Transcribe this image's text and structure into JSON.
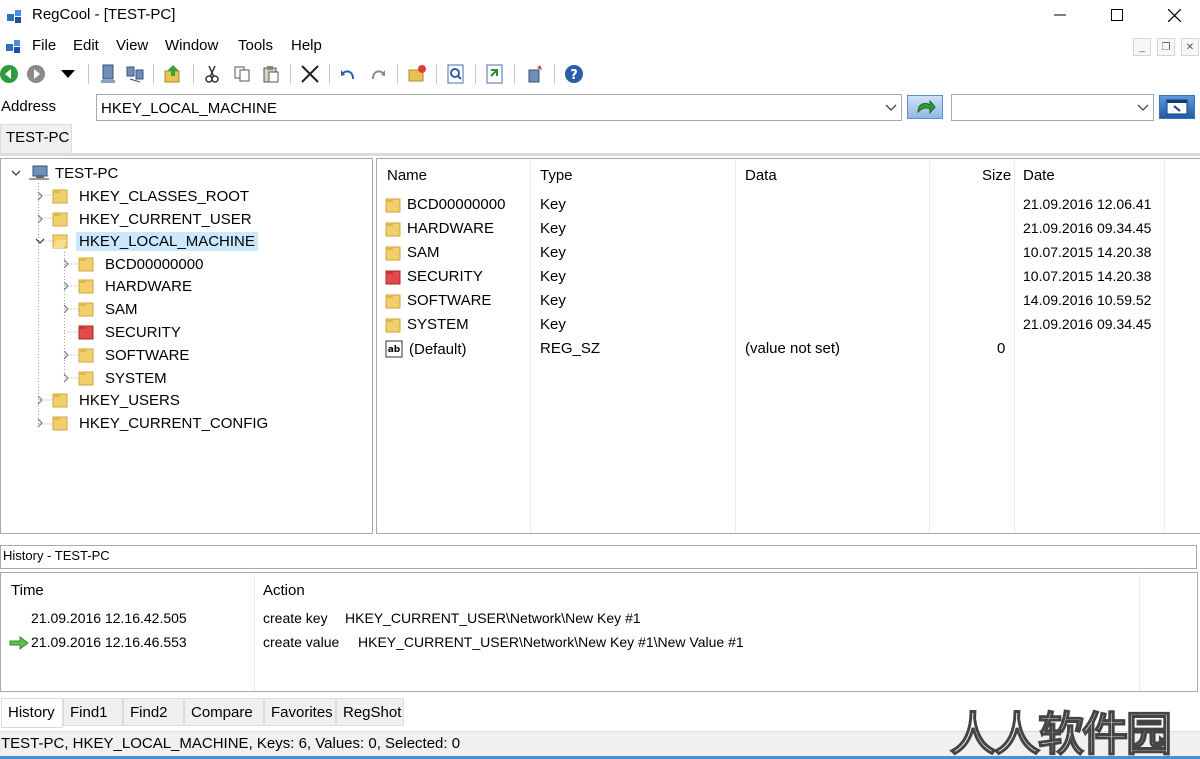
{
  "window": {
    "title": "RegCool - [TEST-PC]",
    "accent_color": "#4a8fd6"
  },
  "menu": [
    "File",
    "Edit",
    "View",
    "Window",
    "Tools",
    "Help"
  ],
  "address": {
    "label": "Address",
    "value": "HKEY_LOCAL_MACHINE",
    "search_placeholder": ""
  },
  "document_tab": "TEST-PC",
  "tree": {
    "root": "TEST-PC",
    "hives": [
      "HKEY_CLASSES_ROOT",
      "HKEY_CURRENT_USER",
      "HKEY_LOCAL_MACHINE",
      "HKEY_USERS",
      "HKEY_CURRENT_CONFIG"
    ],
    "selected": "HKEY_LOCAL_MACHINE",
    "children": [
      "BCD00000000",
      "HARDWARE",
      "SAM",
      "SECURITY",
      "SOFTWARE",
      "SYSTEM"
    ]
  },
  "list": {
    "columns": [
      "Name",
      "Type",
      "Data",
      "Size",
      "Date"
    ],
    "rows": [
      {
        "name": "BCD00000000",
        "type": "Key",
        "data": "",
        "size": "",
        "date": "21.09.2016 12.06.41",
        "icon": "folder-icon"
      },
      {
        "name": "HARDWARE",
        "type": "Key",
        "data": "",
        "size": "",
        "date": "21.09.2016 09.34.45",
        "icon": "folder-icon"
      },
      {
        "name": "SAM",
        "type": "Key",
        "data": "",
        "size": "",
        "date": "10.07.2015 14.20.38",
        "icon": "folder-icon"
      },
      {
        "name": "SECURITY",
        "type": "Key",
        "data": "",
        "size": "",
        "date": "10.07.2015 14.20.38",
        "icon": "red-folder-icon"
      },
      {
        "name": "SOFTWARE",
        "type": "Key",
        "data": "",
        "size": "",
        "date": "14.09.2016 10.59.52",
        "icon": "folder-icon"
      },
      {
        "name": "SYSTEM",
        "type": "Key",
        "data": "",
        "size": "",
        "date": "21.09.2016 09.34.45",
        "icon": "folder-icon"
      },
      {
        "name": "(Default)",
        "type": "REG_SZ",
        "data": "(value not set)",
        "size": "0",
        "date": "",
        "icon": "string-value-icon"
      }
    ]
  },
  "history": {
    "title": "History - TEST-PC",
    "columns": [
      "Time",
      "Action"
    ],
    "rows": [
      {
        "time": "21.09.2016 12.16.42.505",
        "action": "create key",
        "path": "HKEY_CURRENT_USER\\Network\\New Key #1",
        "current": false
      },
      {
        "time": "21.09.2016 12.16.46.553",
        "action": "create value",
        "path": "HKEY_CURRENT_USER\\Network\\New Key #1\\New Value #1",
        "current": true
      }
    ]
  },
  "bottom_tabs": [
    "History",
    "Find1",
    "Find2",
    "Compare",
    "Favorites",
    "RegShot"
  ],
  "status": "TEST-PC, HKEY_LOCAL_MACHINE, Keys: 6, Values: 0, Selected: 0",
  "watermark": "人人软件园"
}
